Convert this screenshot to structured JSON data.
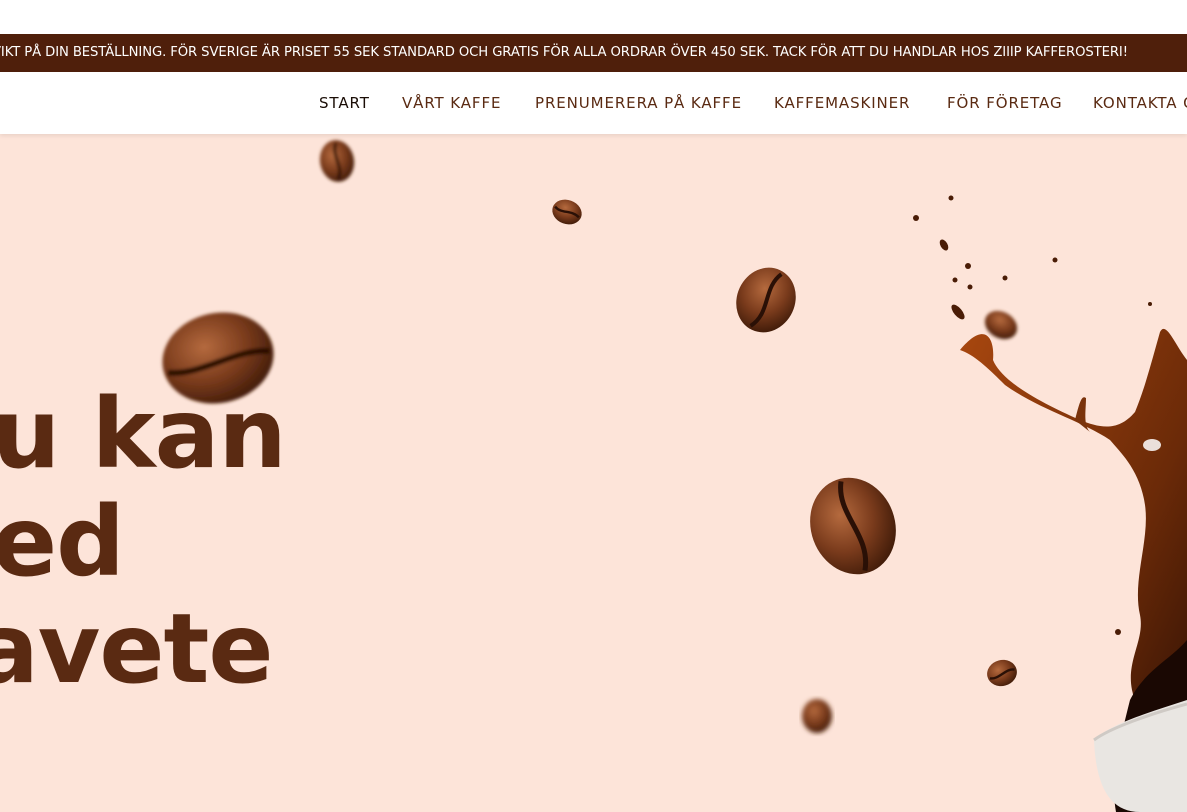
{
  "announcement": {
    "text": "VIKT PÅ DIN BESTÄLLNING. FÖR SVERIGE ÄR PRISET 55 SEK STANDARD OCH GRATIS FÖR ALLA ORDRAR ÖVER 450 SEK. TACK FÖR ATT DU HANDLAR HOS ZIIIP KAFFEROSTERI!"
  },
  "nav": {
    "items": [
      {
        "label": "START",
        "active": true
      },
      {
        "label": "VÅRT KAFFE"
      },
      {
        "label": "PRENUMERERA PÅ KAFFE"
      },
      {
        "label": "KAFFEMASKINER"
      },
      {
        "label": "FÖR FÖRETAG"
      },
      {
        "label": "KONTAKTA O"
      }
    ]
  },
  "hero": {
    "heading_lines": [
      "u kan",
      "ed",
      "avete"
    ]
  },
  "colors": {
    "brand_dark": "#4f1f0b",
    "heading": "#5a2a12",
    "hero_bg": "#fde4d9",
    "coffee": "#3a1a08"
  }
}
